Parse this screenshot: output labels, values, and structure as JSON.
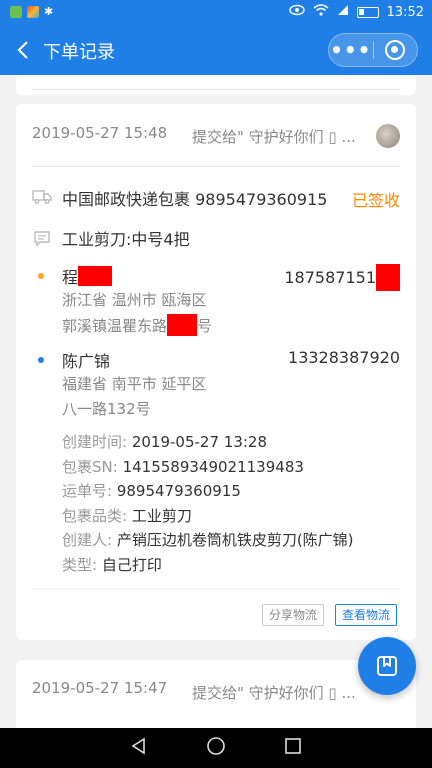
{
  "status_bar": {
    "time": "13:52"
  },
  "nav": {
    "title": "下单记录",
    "more_label": "•••"
  },
  "order": {
    "time": "2019-05-27 15:48",
    "receiver_summary": "提交给\" 守护好你们 ▯ ...",
    "carrier": "中国邮政快递包裹",
    "tracking_no": "9895479360915",
    "status": "已签收",
    "goods": "工业剪刀:中号4把",
    "recipient": {
      "name": "程",
      "phone": "187587151",
      "region": "浙江省 温州市 瓯海区",
      "street_prefix": "郭溪镇温瞿东路",
      "street_suffix": "号"
    },
    "sender": {
      "name": "陈广锦",
      "phone": "13328387920",
      "region": "福建省 南平市 延平区",
      "street": "八一路132号"
    },
    "details": [
      {
        "label": "创建时间: ",
        "value": "2019-05-27 13:28"
      },
      {
        "label": "包裹SN: ",
        "value": "1415589349021139483"
      },
      {
        "label": "运单号: ",
        "value": "9895479360915"
      },
      {
        "label": "包裹品类: ",
        "value": "工业剪刀"
      },
      {
        "label": "创建人: ",
        "value": "产销压边机卷筒机铁皮剪刀(陈广锦)"
      },
      {
        "label": "类型: ",
        "value": "自己打印"
      }
    ],
    "share_label": "分享物流",
    "track_label": "查看物流"
  },
  "next_order": {
    "time": "2019-05-27 15:47",
    "receiver_summary": "提交给\" 守护好你们 ▯ ..."
  },
  "colors": {
    "primary": "#1f7fe6",
    "status_orange": "#ff8a00",
    "recipient_dot": "#f5a623",
    "sender_dot": "#1f7fe6",
    "redaction": "#ff0000"
  }
}
